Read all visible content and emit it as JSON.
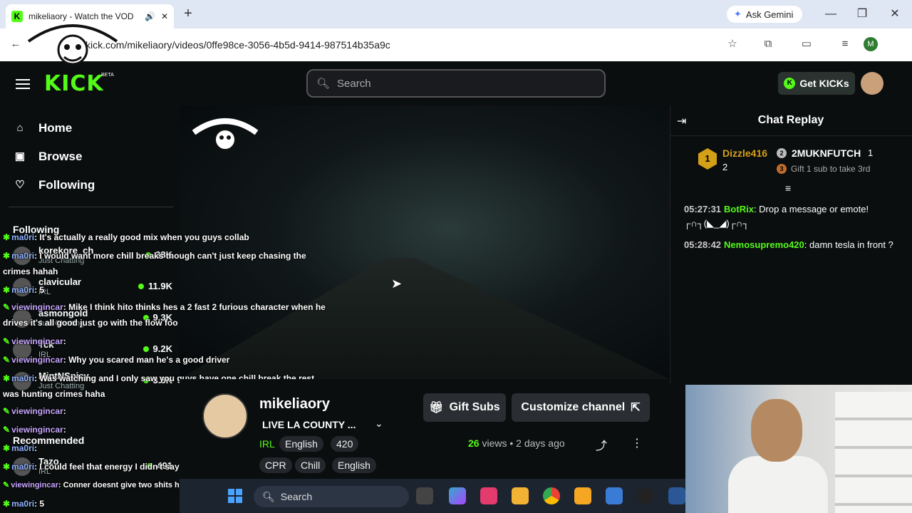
{
  "browser": {
    "tab_title": "mikeliaory - Watch the VOD",
    "url": "kick.com/mikeliaory/videos/0ffe98ce-3056-4b5d-9414-987514b35a9c",
    "ask_gemini": "Ask Gemini",
    "profile_initial": "M"
  },
  "header": {
    "logo": "KICK",
    "beta": "BETA",
    "search_placeholder": "Search",
    "get_kicks": "Get KICKs"
  },
  "sidebar": {
    "nav": [
      {
        "label": "Home",
        "icon": "home-icon"
      },
      {
        "label": "Browse",
        "icon": "browse-icon"
      },
      {
        "label": "Following",
        "icon": "heart-icon"
      }
    ],
    "following_title": "Following",
    "recommended_title": "Recommended",
    "channels": [
      {
        "name": "korekore_ch",
        "category": "Just Chatting",
        "viewers": "38K"
      },
      {
        "name": "clavicular",
        "category": "IRL",
        "viewers": "11.9K"
      },
      {
        "name": "asmongold",
        "category": "Just Chatting",
        "viewers": "9.3K"
      },
      {
        "name": "Tck",
        "category": "IRL",
        "viewers": "9.2K"
      },
      {
        "name": "MintNSpicy",
        "category": "Just Chatting",
        "viewers": "3.5K"
      },
      {
        "name": "Tazo",
        "category": "IRL",
        "viewers": "491"
      }
    ]
  },
  "overlay_chat": [
    {
      "user": "ma0ri",
      "text": ": It's actually a really good mix when you guys collab"
    },
    {
      "user": "ma0ri",
      "text": ": I would want more chill breaks though can't just keep chasing the"
    },
    {
      "user": "",
      "text": "crimes hahah"
    },
    {
      "user": "ma0ri",
      "text": ": 5"
    },
    {
      "user": "viewingincar",
      "text": ": Mike I think hito thinks hes a 2 fast 2 furious character when he"
    },
    {
      "user": "",
      "text": "drives it's all good just go with the flow foo"
    },
    {
      "user": "viewingincar",
      "text": ":"
    },
    {
      "user": "viewingincar",
      "text": ": Why you scared man he's a good driver"
    },
    {
      "user": "ma0ri",
      "text": ": Was watching and I only saw you guys have one chill break the rest"
    },
    {
      "user": "",
      "text": "was hunting crimes haha"
    },
    {
      "user": "viewingincar",
      "text": ":"
    },
    {
      "user": "viewingincar",
      "text": ":"
    },
    {
      "user": "ma0ri",
      "text": ":"
    },
    {
      "user": "ma0ri",
      "text": ": I could feel that energy I didn't say nothing though"
    },
    {
      "user": "viewingincar",
      "text": ": Conner doesnt give two shits hes so close that's crazy 😂"
    },
    {
      "user": "ma0ri",
      "text": ": 5"
    }
  ],
  "channel": {
    "name": "mikeliaory",
    "stream_title": "LIVE LA COUNTY ...",
    "tags_row1": [
      "IRL",
      "English",
      "420"
    ],
    "tags_row2": [
      "CPR",
      "Chill",
      "English"
    ],
    "gift_subs": "Gift Subs",
    "customize": "Customize channel",
    "views_count": "26",
    "views_label": "views",
    "posted": "2 days ago"
  },
  "chat": {
    "title": "Chat Replay",
    "leaderboard": [
      {
        "rank": "1",
        "name": "Dizzle416",
        "count": "2"
      },
      {
        "rank": "2",
        "name": "2MUKNFUTCH",
        "count": "1"
      },
      {
        "rank": "3",
        "name": "Gift 1 sub to take 3rd",
        "count": ""
      }
    ],
    "messages": [
      {
        "time": "05:27:31",
        "user": "BotRix",
        "text": ": Drop a message or emote! ┌∩┐(◣_◢)┌∩┐"
      },
      {
        "time": "05:28:42",
        "user": "Nemosupremo420",
        "text": ": damn tesla in front ?"
      }
    ]
  },
  "taskbar": {
    "search_placeholder": "Search"
  },
  "colors": {
    "kick_green": "#53fc18",
    "background": "#0b0e0f",
    "gold": "#d4a017"
  }
}
